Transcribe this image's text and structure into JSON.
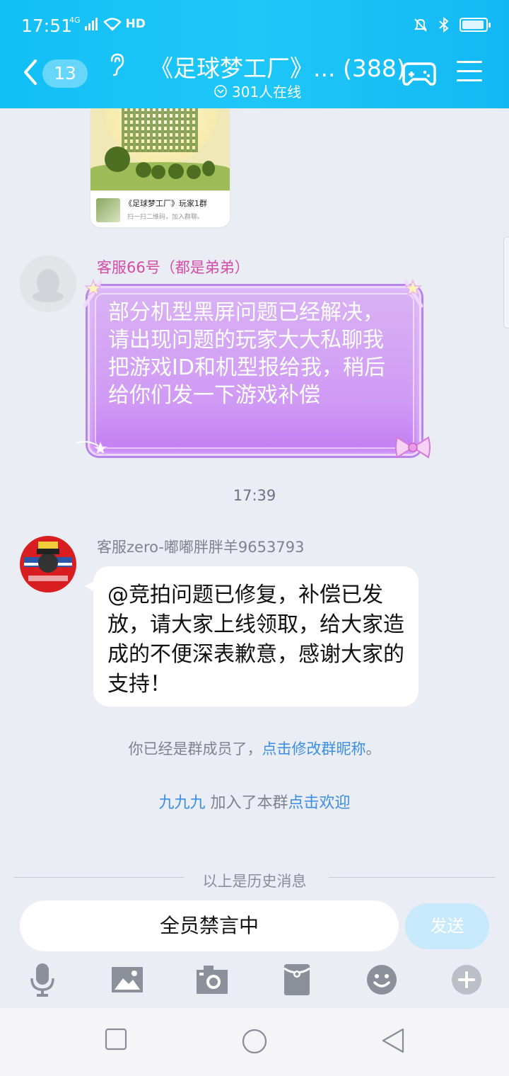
{
  "status_bar": {
    "time": "17:51",
    "network": "4G",
    "hd": "HD"
  },
  "header": {
    "unread_count": "13",
    "title": "《足球梦工厂》... (388)",
    "online": "301人在线"
  },
  "qr_card": {
    "group_name": "《足球梦工厂》玩家1群",
    "hint": "扫一扫二维码，加入群聊。"
  },
  "messages": [
    {
      "sender": "客服66号（都是弟弟）",
      "text": "部分机型黑屏问题已经解决，请出现问题的玩家大大私聊我把游戏ID和机型报给我，稍后给你们发一下游戏补偿"
    },
    {
      "sender": "客服zero-嘟嘟胖胖羊9653793",
      "text": "@竞拍问题已修复，补偿已发放，请大家上线领取，给大家造成的不便深表歉意，感谢大家的支持！"
    }
  ],
  "timestamp": "17:39",
  "system": {
    "member_text": "你已经是群成员了，",
    "member_link": "点击修改群昵称",
    "member_end": "。",
    "join_name": "九九九",
    "join_text": " 加入了本群",
    "join_link": "点击欢迎"
  },
  "history_label": "以上是历史消息",
  "input": {
    "text": "全员禁言中",
    "send_label": "发送"
  },
  "colors": {
    "header": "#12bff6",
    "link": "#3a8ee6",
    "sender_pink": "#d44ca6",
    "bubble_purple": "#cf99f4"
  },
  "icons": [
    "back-icon",
    "ear-icon",
    "gamepad-icon",
    "menu-icon",
    "microphone-icon",
    "image-icon",
    "camera-icon",
    "red-packet-icon",
    "emoji-icon",
    "plus-icon"
  ]
}
